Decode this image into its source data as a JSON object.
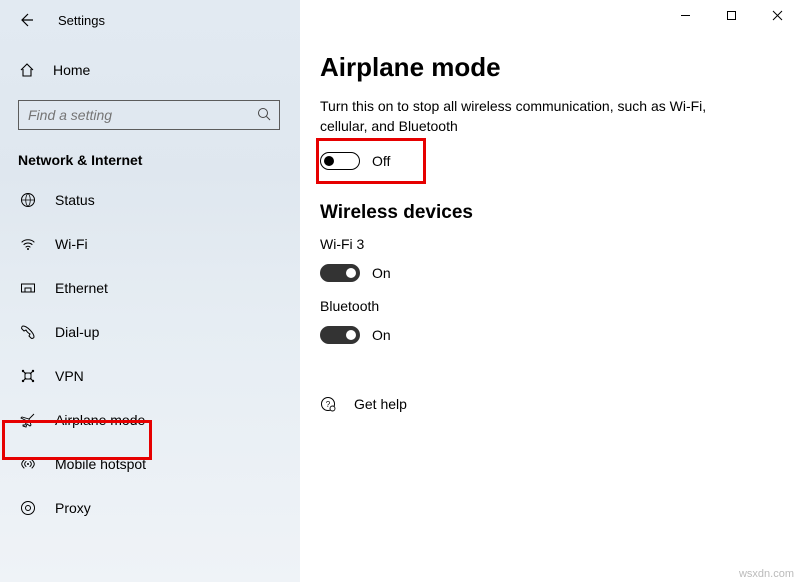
{
  "window": {
    "title": "Settings",
    "minimize": "—",
    "maximize": "▢",
    "close": "✕"
  },
  "sidebar": {
    "home_label": "Home",
    "search_placeholder": "Find a setting",
    "category": "Network & Internet",
    "items": [
      {
        "icon": "status-icon",
        "label": "Status"
      },
      {
        "icon": "wifi-icon",
        "label": "Wi-Fi"
      },
      {
        "icon": "ethernet-icon",
        "label": "Ethernet"
      },
      {
        "icon": "dialup-icon",
        "label": "Dial-up"
      },
      {
        "icon": "vpn-icon",
        "label": "VPN"
      },
      {
        "icon": "airplane-icon",
        "label": "Airplane mode"
      },
      {
        "icon": "hotspot-icon",
        "label": "Mobile hotspot"
      },
      {
        "icon": "proxy-icon",
        "label": "Proxy"
      }
    ]
  },
  "main": {
    "title": "Airplane mode",
    "description": "Turn this on to stop all wireless communication, such as Wi-Fi, cellular, and Bluetooth",
    "airplane": {
      "state_label": "Off",
      "on": false
    },
    "wireless_header": "Wireless devices",
    "devices": [
      {
        "name": "Wi-Fi 3",
        "state_label": "On",
        "on": true
      },
      {
        "name": "Bluetooth",
        "state_label": "On",
        "on": true
      }
    ],
    "help_label": "Get help"
  },
  "watermark": "wsxdn.com"
}
